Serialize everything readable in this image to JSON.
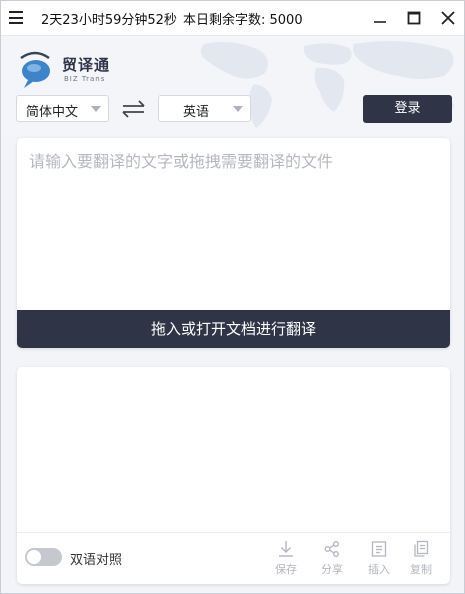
{
  "titlebar": {
    "timer": "2天23小时59分钟52秒",
    "quota": "本日剩余字数: 5000"
  },
  "logo": {
    "name_cn": "贸译通",
    "name_en": "BIZ Trans"
  },
  "language": {
    "source": "简体中文",
    "target": "英语"
  },
  "header": {
    "login_label": "登录"
  },
  "input": {
    "placeholder": "请输入要翻译的文字或拖拽需要翻译的文件",
    "drop_label": "拖入或打开文档进行翻译"
  },
  "output": {
    "bilingual_label": "双语对照",
    "bilingual_on": false,
    "actions": [
      {
        "label": "保存",
        "icon": "download-icon"
      },
      {
        "label": "分享",
        "icon": "share-icon"
      },
      {
        "label": "插入",
        "icon": "insert-icon"
      },
      {
        "label": "复制",
        "icon": "copy-icon"
      }
    ]
  },
  "colors": {
    "accent": "#2f3447",
    "background": "#f2f4f8",
    "muted_icon": "#b4b7bf"
  }
}
